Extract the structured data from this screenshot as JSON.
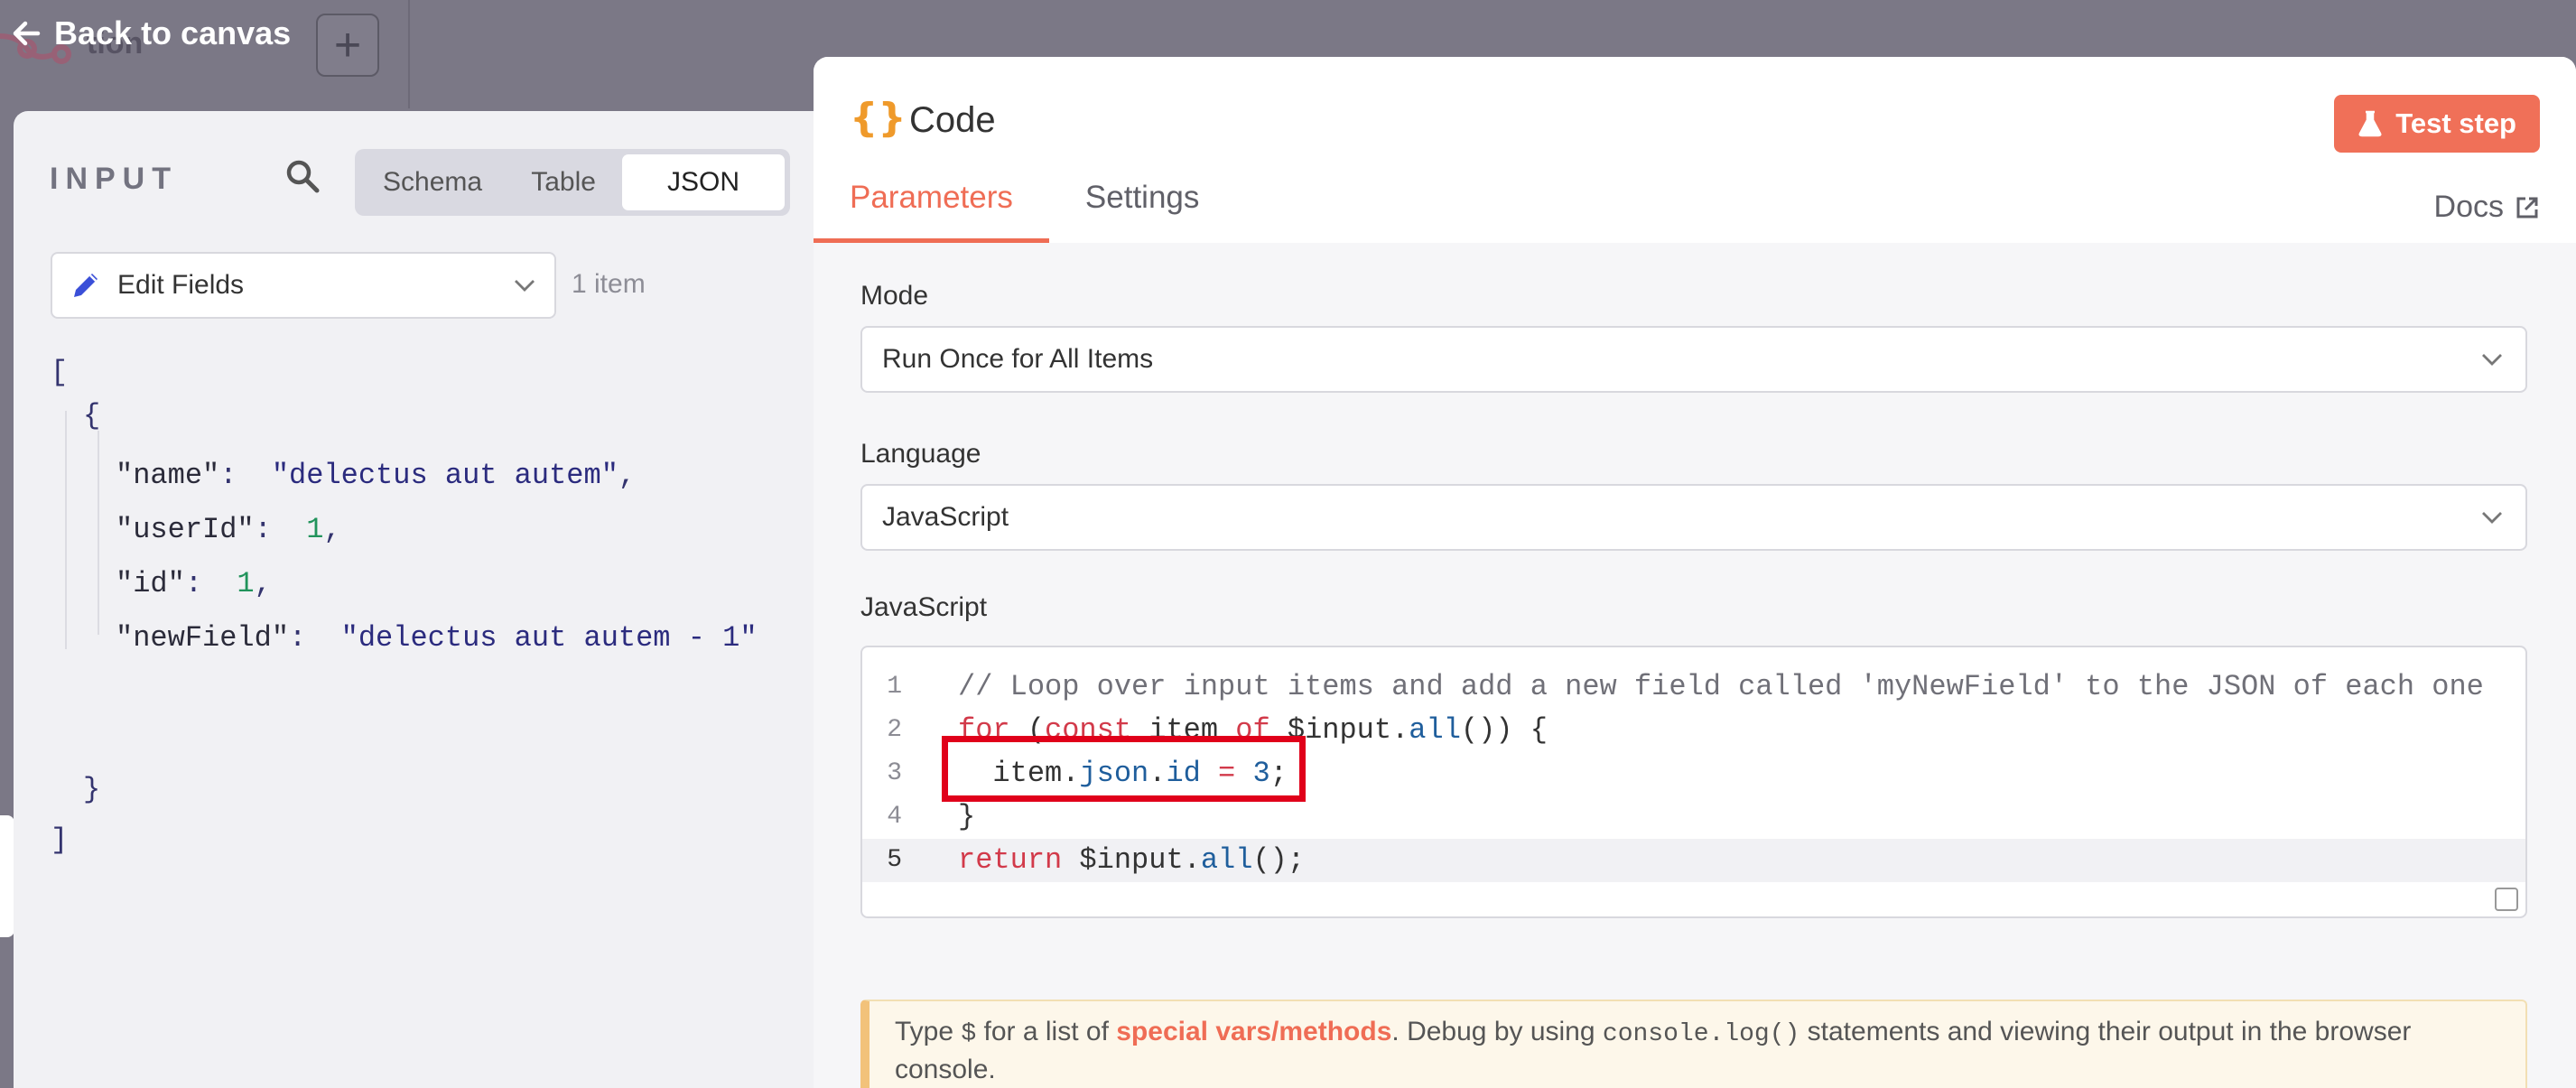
{
  "canvas": {
    "back_label": "Back to canvas",
    "node_name_fragment": "tion",
    "add_button": "+"
  },
  "input_panel": {
    "title": "INPUT",
    "view_modes": [
      "Schema",
      "Table",
      "JSON"
    ],
    "active_view": "JSON",
    "source_node": "Edit Fields",
    "item_count": "1 item",
    "json": {
      "open_bracket": "[",
      "open_brace": "{",
      "lines": [
        {
          "key": "\"name\"",
          "value": "\"delectus aut autem\"",
          "suffix": ",",
          "kind": "str"
        },
        {
          "key": "\"userId\"",
          "value": "1",
          "suffix": ",",
          "kind": "num"
        },
        {
          "key": "\"id\"",
          "value": "1",
          "suffix": ",",
          "kind": "num"
        },
        {
          "key": "\"newField\"",
          "value": "\"delectus aut autem - 1\"",
          "suffix": "",
          "kind": "str"
        }
      ],
      "close_brace": "}",
      "close_bracket": "]"
    }
  },
  "code_panel": {
    "icon": "{}",
    "title": "Code",
    "test_button": "Test step",
    "tabs": [
      "Parameters",
      "Settings"
    ],
    "active_tab": "Parameters",
    "docs_label": "Docs",
    "mode_label": "Mode",
    "mode_value": "Run Once for All Items",
    "language_label": "Language",
    "language_value": "JavaScript",
    "editor_label": "JavaScript",
    "code_lines": [
      {
        "n": "1",
        "text": "// Loop over input items and add a new field called 'myNewField' to the JSON of each one"
      },
      {
        "n": "2",
        "text": "for (const item of $input.all()) {"
      },
      {
        "n": "3",
        "text": "  item.json.id = 3;"
      },
      {
        "n": "4",
        "text": "}"
      },
      {
        "n": "5",
        "text": "return $input.all();"
      }
    ],
    "current_line": "5",
    "hint": {
      "prefix": "Type ",
      "dollar": "$",
      "mid1": " for a list of ",
      "link": "special vars/methods",
      "mid2": ". Debug by using ",
      "code": "console.log()",
      "suffix": " statements and viewing their output in the browser console."
    }
  },
  "colors": {
    "accent": "#ef6d55",
    "code_icon": "#ef9a2b",
    "highlight_box": "#e0001a"
  }
}
